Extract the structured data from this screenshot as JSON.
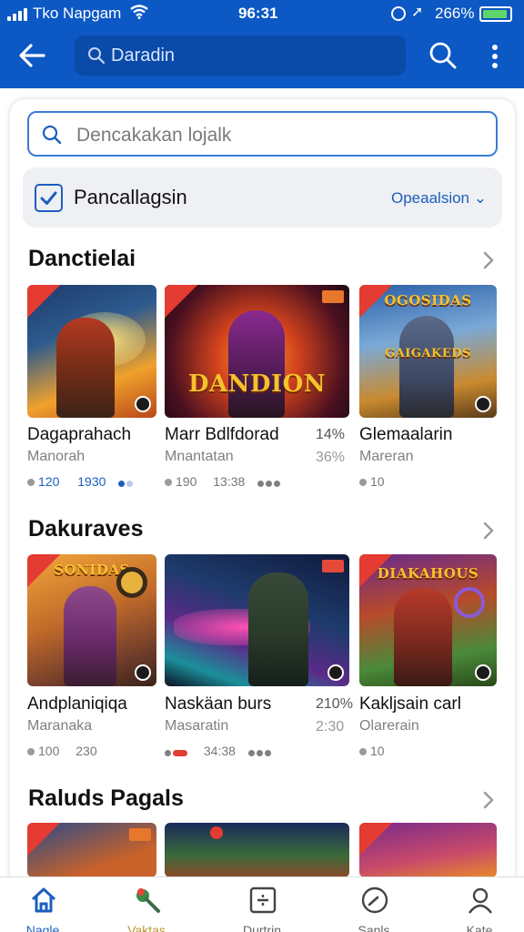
{
  "status_bar": {
    "carrier": "Tko Napgam",
    "time": "96:31",
    "battery_text": "266%",
    "icons": [
      "signal-icon",
      "wifi-icon",
      "alarm-icon",
      "location-icon",
      "battery-icon"
    ]
  },
  "app_bar": {
    "search_text": "Daradin",
    "icons": [
      "back-arrow-icon",
      "search-icon",
      "more-vert-icon"
    ],
    "color": "#0c58c4"
  },
  "search_field": {
    "placeholder": "Dencakakan lojalk"
  },
  "filter": {
    "checked": true,
    "label": "Pancallagsin",
    "dropdown": "Opeaalsion"
  },
  "sections": [
    {
      "title": "Danctielai",
      "items": [
        {
          "name": "Dagaprahach",
          "sub": "Manorah",
          "stat_a": "120",
          "stat_b": "1930"
        },
        {
          "name": "Marr Bdlfdorad",
          "sub": "Mnantatan",
          "pct_a": "14%",
          "pct_b": "36%",
          "stat_a": "190",
          "stat_b": "13:38",
          "logo": "DANDION"
        },
        {
          "name": "Glemaalarin",
          "sub": "Mareran",
          "stat_a": "10",
          "logo": "GAIGAKEDS"
        }
      ]
    },
    {
      "title": "Dakuraves",
      "items": [
        {
          "name": "Andplaniqiqa",
          "sub": "Maranaka",
          "stat_a": "100",
          "stat_b": "230",
          "logo": "SONIDAS"
        },
        {
          "name": "Naskäan burs",
          "sub": "Masaratin",
          "pct_a": "210%",
          "pct_b": "2:30",
          "stat_b": "34:38"
        },
        {
          "name": "Kakljsain carl",
          "sub": "Olarerain",
          "stat_a": "10",
          "logo": "DIAKAHOUS"
        }
      ]
    },
    {
      "title": "Raluds Pagals"
    }
  ],
  "bottom_nav": [
    {
      "label": "Nagle",
      "icon": "home-icon",
      "active": true
    },
    {
      "label": "Vaktas",
      "icon": "game-controller-icon"
    },
    {
      "label": "Durtrin",
      "icon": "board-icon"
    },
    {
      "label": "Sanls",
      "icon": "compass-icon"
    },
    {
      "label": "Kate",
      "icon": "profile-icon"
    }
  ],
  "colors": {
    "accent": "#1d5fbf",
    "active_nav": "#1d5fbf",
    "badge_red": "#e43b32"
  }
}
